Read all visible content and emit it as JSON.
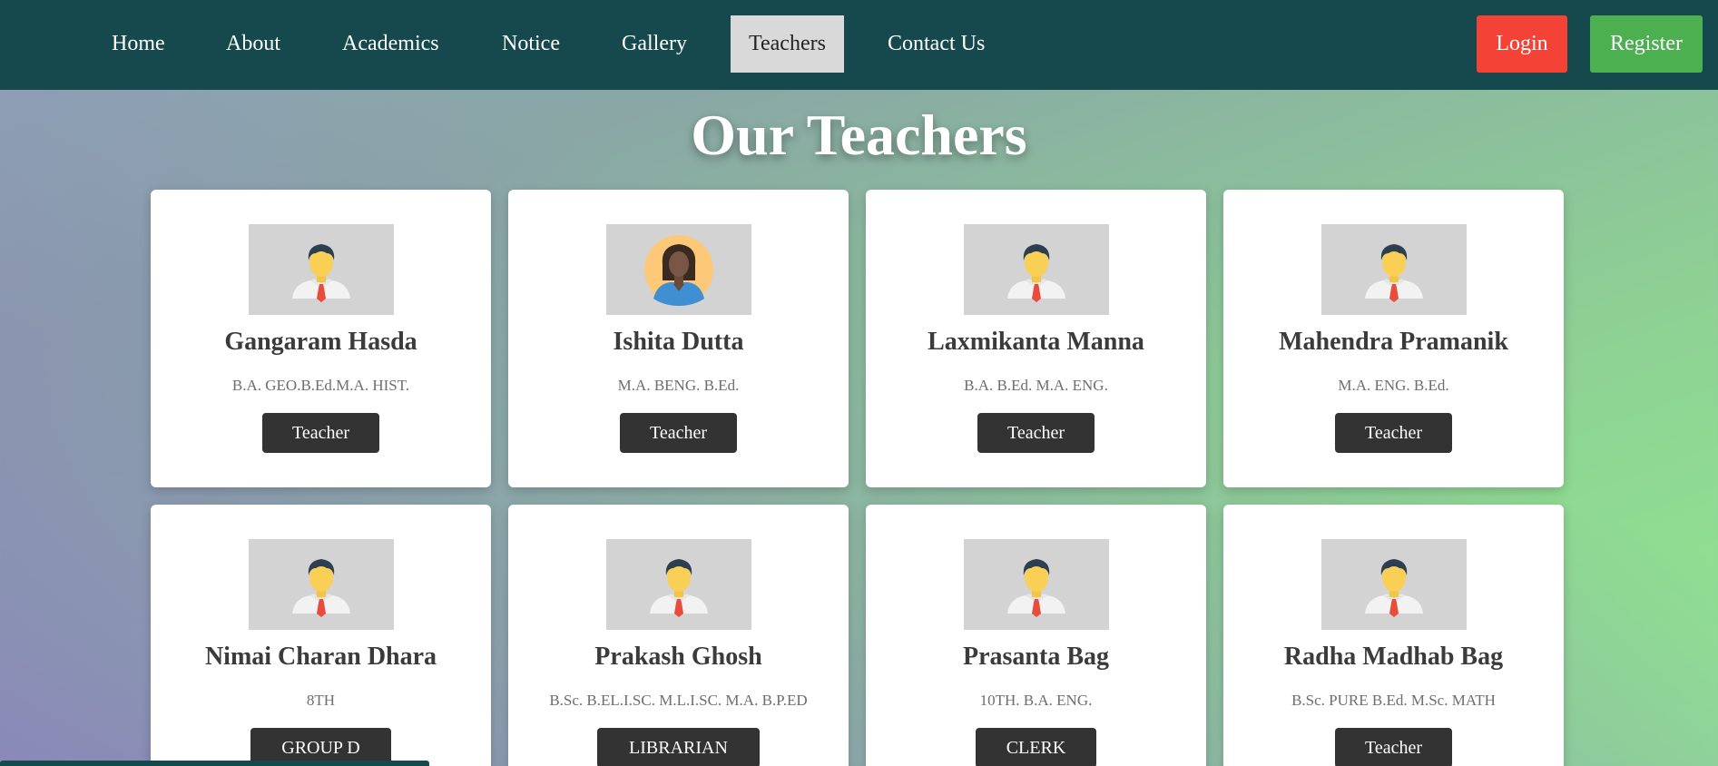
{
  "nav": {
    "items": [
      {
        "label": "Home",
        "active": false
      },
      {
        "label": "About",
        "active": false
      },
      {
        "label": "Academics",
        "active": false
      },
      {
        "label": "Notice",
        "active": false
      },
      {
        "label": "Gallery",
        "active": false
      },
      {
        "label": "Teachers",
        "active": true
      },
      {
        "label": "Contact Us",
        "active": false
      }
    ],
    "login_label": "Login",
    "register_label": "Register"
  },
  "colors": {
    "navbar": "#15494d",
    "login": "#f44336",
    "register": "#4caf50",
    "role_button": "#333333"
  },
  "main": {
    "title": "Our Teachers",
    "teachers": [
      {
        "name": "Gangaram Hasda",
        "qualification": "B.A. GEO.B.Ed.M.A. HIST.",
        "role": "Teacher",
        "avatar_icon": "male-avatar-icon"
      },
      {
        "name": "Ishita Dutta",
        "qualification": "M.A. BENG. B.Ed.",
        "role": "Teacher",
        "avatar_icon": "female-avatar-icon"
      },
      {
        "name": "Laxmikanta Manna",
        "qualification": "B.A. B.Ed. M.A. ENG.",
        "role": "Teacher",
        "avatar_icon": "male-avatar-icon"
      },
      {
        "name": "Mahendra Pramanik",
        "qualification": "M.A. ENG. B.Ed.",
        "role": "Teacher",
        "avatar_icon": "male-avatar-icon"
      },
      {
        "name": "Nimai Charan Dhara",
        "qualification": "8TH",
        "role": "GROUP D",
        "avatar_icon": "male-avatar-icon"
      },
      {
        "name": "Prakash Ghosh",
        "qualification": "B.Sc. B.EL.I.SC. M.L.I.SC. M.A. B.P.ED",
        "role": "LIBRARIAN",
        "avatar_icon": "male-avatar-icon"
      },
      {
        "name": "Prasanta Bag",
        "qualification": "10TH. B.A. ENG.",
        "role": "CLERK",
        "avatar_icon": "male-avatar-icon"
      },
      {
        "name": "Radha Madhab Bag",
        "qualification": "B.Sc. PURE B.Ed. M.Sc. MATH",
        "role": "Teacher",
        "avatar_icon": "male-avatar-icon"
      }
    ]
  }
}
